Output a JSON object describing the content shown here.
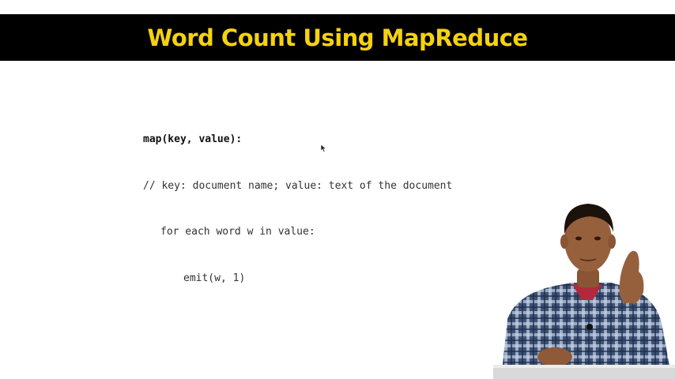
{
  "slide": {
    "title": "Word Count Using MapReduce",
    "code": {
      "signature": "map(key, value):",
      "comment": "// key: document name; value: text of the document",
      "loop": "for each word w in value:",
      "body": "emit(w, 1)"
    }
  },
  "colors": {
    "title_text": "#f5d20f",
    "title_bar": "#000000",
    "background": "#ffffff",
    "code_text": "#333333"
  },
  "icons": {
    "cursor": "mouse-pointer-icon"
  }
}
